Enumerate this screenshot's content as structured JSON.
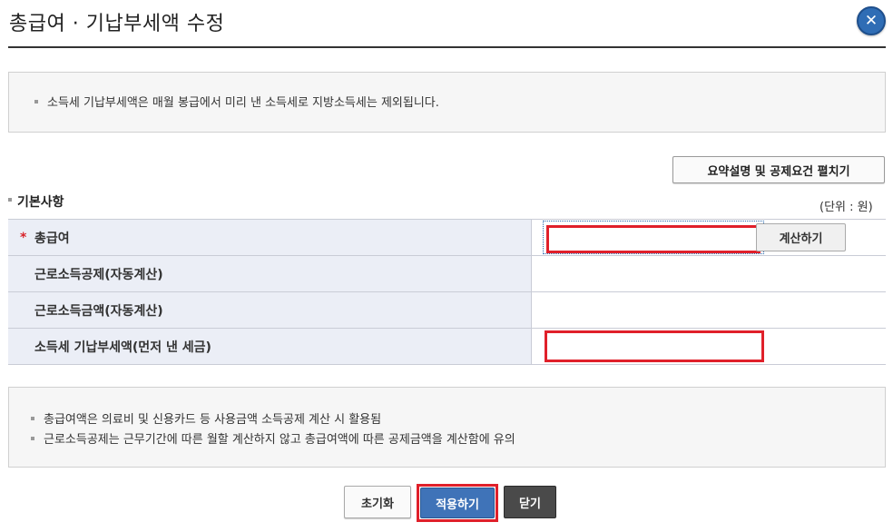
{
  "dialog": {
    "title": "총급여 · 기납부세액 수정",
    "close_label": "✕"
  },
  "top_notice": {
    "lines": [
      "소득세 기납부세액은 매월 봉급에서 미리 낸 소득세로 지방소득세는 제외됩니다."
    ]
  },
  "expand_button": "요약설명 및 공제요건 펼치기",
  "section": {
    "title": "기본사항",
    "unit": "(단위 : 원)"
  },
  "form": {
    "rows": [
      {
        "required_mark": "*",
        "label": "총급여",
        "value": ""
      },
      {
        "label": "근로소득공제(자동계산)",
        "value": ""
      },
      {
        "label": "근로소득금액(자동계산)",
        "value": ""
      },
      {
        "label": "소득세 기납부세액(먼저 낸 세금)",
        "value": ""
      }
    ],
    "calc_button": "계산하기"
  },
  "bottom_notice": {
    "lines": [
      "총급여액은 의료비 및 신용카드 등 사용금액 소득공제 계산 시 활용됨",
      "근로소득공제는 근무기간에 따른 월할 계산하지 않고 총급여액에 따른 공제금액을 계산함에 유의"
    ]
  },
  "buttons": {
    "reset": "초기화",
    "apply": "적용하기",
    "close": "닫기"
  },
  "colors": {
    "accent_blue": "#3f73b8",
    "highlight_red": "#e0202a",
    "header_bg": "#ebeef6",
    "close_dark": "#4a4a4a"
  }
}
